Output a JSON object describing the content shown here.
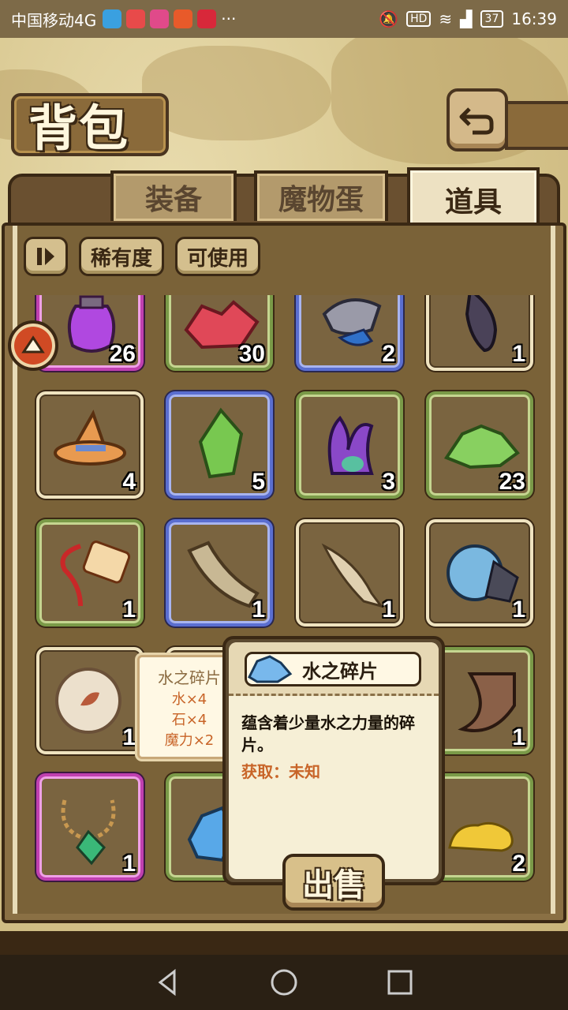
{
  "status_bar": {
    "carrier": "中国移动4G",
    "more": "···",
    "battery": "37",
    "time": "16:39",
    "icons": [
      "mute-icon",
      "hd-icon",
      "wifi-icon",
      "signal-icon"
    ]
  },
  "header": {
    "title": "背包",
    "back_icon": "back-arrow-icon"
  },
  "tabs": [
    {
      "label": "装备",
      "active": false
    },
    {
      "label": "魔物蛋",
      "active": false
    },
    {
      "label": "道具",
      "active": true
    }
  ],
  "filters": {
    "toggle_icon": "pause-filter-icon",
    "rarity": "稀有度",
    "usable": "可使用"
  },
  "items": [
    {
      "icon": "purple-potion-vase",
      "qty": "26",
      "rarity": "purple"
    },
    {
      "icon": "red-crystals",
      "qty": "30",
      "rarity": "green"
    },
    {
      "icon": "gray-fish-creature",
      "qty": "2",
      "rarity": "blue"
    },
    {
      "icon": "dark-seed",
      "qty": "1",
      "rarity": "common"
    },
    {
      "icon": "orange-witch-hat",
      "qty": "4",
      "rarity": "common"
    },
    {
      "icon": "green-crystal",
      "qty": "5",
      "rarity": "blue"
    },
    {
      "icon": "purple-tentacle-monster",
      "qty": "3",
      "rarity": "green"
    },
    {
      "icon": "green-crystal-cluster",
      "qty": "23",
      "rarity": "green"
    },
    {
      "icon": "red-charm-tag",
      "qty": "1",
      "rarity": "green"
    },
    {
      "icon": "wooden-plank",
      "qty": "1",
      "rarity": "blue"
    },
    {
      "icon": "small-fish",
      "qty": "1",
      "rarity": "common"
    },
    {
      "icon": "blue-shell",
      "qty": "1",
      "rarity": "common"
    },
    {
      "icon": "leaf-orb",
      "qty": "1",
      "rarity": "common"
    },
    {
      "icon": "hidden-item",
      "qty": "",
      "rarity": "common"
    },
    {
      "icon": "hidden-item",
      "qty": "",
      "rarity": "common"
    },
    {
      "icon": "brown-horn",
      "qty": "1",
      "rarity": "green"
    },
    {
      "icon": "green-gem-necklace",
      "qty": "1",
      "rarity": "purple"
    },
    {
      "icon": "blue-water-shards",
      "qty": "",
      "rarity": "green"
    },
    {
      "icon": "hidden-item",
      "qty": "",
      "rarity": "common"
    },
    {
      "icon": "yellow-slime",
      "qty": "2",
      "rarity": "green"
    }
  ],
  "recipe": {
    "title": "水之碎片",
    "lines": [
      "水×4",
      "石×4",
      "魔力×2"
    ]
  },
  "detail": {
    "name": "水之碎片",
    "description": "蕴含着少量水之力量的碎片。",
    "source": "获取：未知",
    "sell_label": "出售"
  },
  "nav": [
    "back-nav-icon",
    "home-nav-icon",
    "recents-nav-icon"
  ]
}
